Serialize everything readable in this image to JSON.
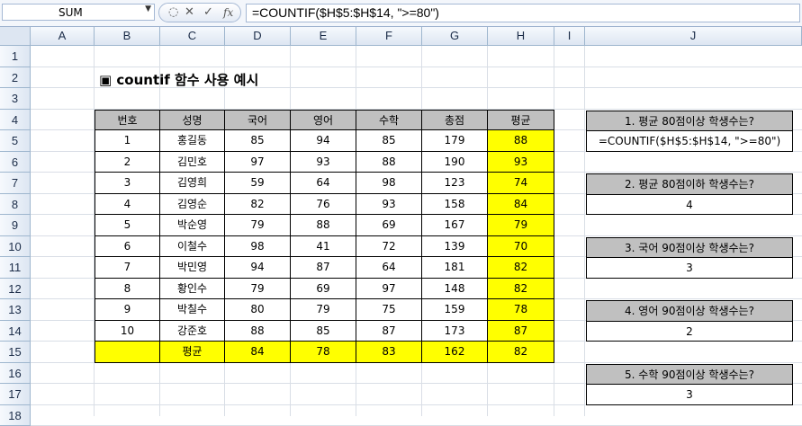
{
  "formula_bar": {
    "name_box": "SUM",
    "formula": "=COUNTIF($H$5:$H$14, \">=80\")"
  },
  "columns": [
    "A",
    "B",
    "C",
    "D",
    "E",
    "F",
    "G",
    "H",
    "I",
    "J"
  ],
  "rows": [
    "1",
    "2",
    "3",
    "4",
    "5",
    "6",
    "7",
    "8",
    "9",
    "10",
    "11",
    "12",
    "13",
    "14",
    "15",
    "16",
    "17",
    "18"
  ],
  "title": "▣ countif 함수 사용 예시",
  "table": {
    "headers": [
      "번호",
      "성명",
      "국어",
      "영어",
      "수학",
      "총점",
      "평균"
    ],
    "rows": [
      [
        "1",
        "홍길동",
        "85",
        "94",
        "85",
        "179",
        "88"
      ],
      [
        "2",
        "김민호",
        "97",
        "93",
        "88",
        "190",
        "93"
      ],
      [
        "3",
        "김영희",
        "59",
        "64",
        "98",
        "123",
        "74"
      ],
      [
        "4",
        "김영순",
        "82",
        "76",
        "93",
        "158",
        "84"
      ],
      [
        "5",
        "박순영",
        "79",
        "88",
        "69",
        "167",
        "79"
      ],
      [
        "6",
        "이철수",
        "98",
        "41",
        "72",
        "139",
        "70"
      ],
      [
        "7",
        "박민영",
        "94",
        "87",
        "64",
        "181",
        "82"
      ],
      [
        "8",
        "황인수",
        "79",
        "69",
        "97",
        "148",
        "82"
      ],
      [
        "9",
        "박칠수",
        "80",
        "79",
        "75",
        "159",
        "78"
      ],
      [
        "10",
        "강준호",
        "88",
        "85",
        "87",
        "173",
        "87"
      ]
    ],
    "average_row": [
      "",
      "평균",
      "84",
      "78",
      "83",
      "162",
      "82"
    ]
  },
  "questions": [
    {
      "label": "1. 평균 80점이상 학생수는?",
      "answer": "=COUNTIF($H$5:$H$14, \">=80\")"
    },
    {
      "label": "2. 평균 80점이하 학생수는?",
      "answer": "4"
    },
    {
      "label": "3. 국어 90점이상 학생수는?",
      "answer": "3"
    },
    {
      "label": "4. 영어 90점이상 학생수는?",
      "answer": "2"
    },
    {
      "label": "5. 수학 90점이상 학생수는?",
      "answer": "3"
    }
  ],
  "colors": {
    "header": "#c0c0c0",
    "highlight": "#ffff00",
    "grid": "#d9dee6"
  }
}
